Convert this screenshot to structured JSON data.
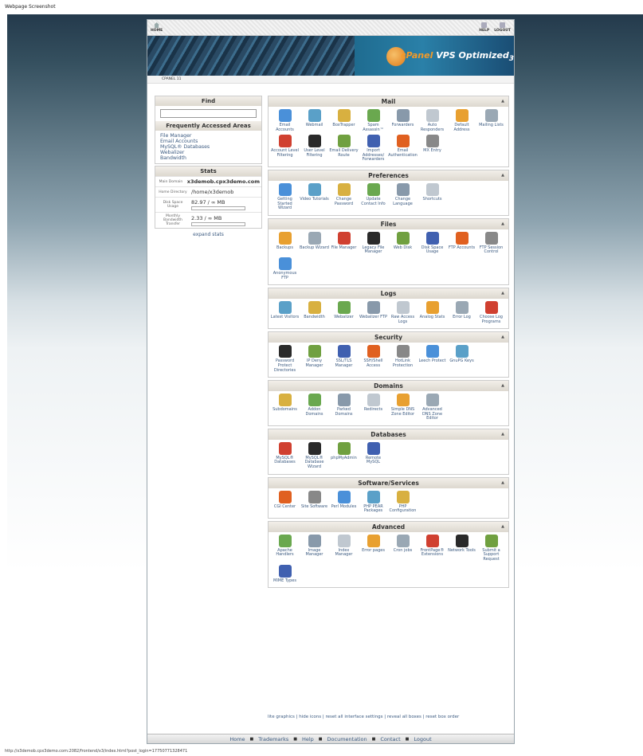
{
  "page_label": "Webpage Screenshot",
  "status_url": "http://x3demob.cpx3demo.com:2082/frontend/x3/index.html?post_login=17750771328471",
  "topbar": {
    "home": "HOME",
    "help": "HELP",
    "logout": "LOGOUT"
  },
  "banner": {
    "brand": "cPanel",
    "brand_rest": "VPS Optimized",
    "brand_sub": "3"
  },
  "breadcrumb": "CPANEL 11",
  "find": {
    "title": "Find"
  },
  "frequent": {
    "title": "Frequently Accessed Areas",
    "links": [
      "File Manager",
      "Email Accounts",
      "MySQL® Databases",
      "Webalizer",
      "Bandwidth"
    ]
  },
  "stats": {
    "title": "Stats",
    "rows": [
      {
        "label": "Main Domain",
        "value": "x3demob.cpx3demo.com"
      },
      {
        "label": "Home Directory",
        "value": "/home/x3demob"
      },
      {
        "label": "Disk Space Usage",
        "value": "82.97 / ∞ MB"
      },
      {
        "label": "Monthly Bandwidth Transfer",
        "value": "2.33 / ∞ MB"
      }
    ],
    "expand": "expand stats"
  },
  "sections": [
    {
      "title": "Mail",
      "items": [
        "Email Accounts",
        "Webmail",
        "BoxTrapper",
        "Spam Assassin™",
        "Forwarders",
        "Auto Responders",
        "Default Address",
        "Mailing Lists",
        "Account Level Filtering",
        "User Level Filtering",
        "Email Delivery Route",
        "Import Addresses/ Forwarders",
        "Email Authentication",
        "MX Entry"
      ]
    },
    {
      "title": "Preferences",
      "items": [
        "Getting Started Wizard",
        "Video Tutorials",
        "Change Password",
        "Update Contact Info",
        "Change Language",
        "Shortcuts"
      ]
    },
    {
      "title": "Files",
      "items": [
        "Backups",
        "Backup Wizard",
        "File Manager",
        "Legacy File Manager",
        "Web Disk",
        "Disk Space Usage",
        "FTP Accounts",
        "FTP Session Control",
        "Anonymous FTP"
      ]
    },
    {
      "title": "Logs",
      "items": [
        "Latest Visitors",
        "Bandwidth",
        "Webalizer",
        "Webalizer FTP",
        "Raw Access Logs",
        "Analog Stats",
        "Error Log",
        "Choose Log Programs"
      ]
    },
    {
      "title": "Security",
      "items": [
        "Password Protect Directories",
        "IP Deny Manager",
        "SSL/TLS Manager",
        "SSH/Shell Access",
        "HotLink Protection",
        "Leech Protect",
        "GnuPG Keys"
      ]
    },
    {
      "title": "Domains",
      "items": [
        "Subdomains",
        "Addon Domains",
        "Parked Domains",
        "Redirects",
        "Simple DNS Zone Editor",
        "Advanced DNS Zone Editor"
      ]
    },
    {
      "title": "Databases",
      "items": [
        "MySQL® Databases",
        "MySQL® Database Wizard",
        "phpMyAdmin",
        "Remote MySQL"
      ]
    },
    {
      "title": "Software/Services",
      "items": [
        "CGI Center",
        "Site Software",
        "Perl Modules",
        "PHP PEAR Packages",
        "PHP Configuration"
      ]
    },
    {
      "title": "Advanced",
      "items": [
        "Apache Handlers",
        "Image Manager",
        "Index Manager",
        "Error pages",
        "Cron jobs",
        "FrontPage® Extensions",
        "Network Tools",
        "Submit a Support Request",
        "MIME Types"
      ]
    }
  ],
  "options_links": "lite graphics | hide icons | reset all interface settings | reveal all boxes | reset box order",
  "nav": [
    "Home",
    "Trademarks",
    "Help",
    "Documentation",
    "Contact",
    "Logout"
  ],
  "icon_colors": [
    "#4a90d9",
    "#5aa0c8",
    "#d8b040",
    "#6aa84f",
    "#8899aa",
    "#c0c8d0",
    "#e8a030",
    "#9aa8b4",
    "#d04030",
    "#2a2a2a",
    "#70a040",
    "#4060b0",
    "#e06020",
    "#888888"
  ]
}
